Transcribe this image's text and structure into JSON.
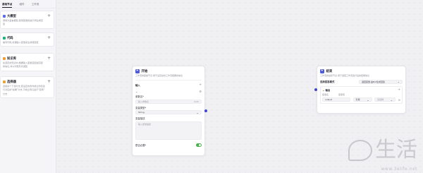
{
  "panel": {
    "tabs": [
      {
        "label": "基础节点"
      },
      {
        "label": "组件"
      },
      {
        "label": "工作流"
      }
    ],
    "cards": [
      {
        "title": "大模型",
        "desc_lines": [
          "调用大语言模型,使用变量和提示词生成回",
          "复"
        ],
        "color": "#5b6cf0",
        "icon": "brain-icon"
      },
      {
        "title": "代码",
        "desc_lines": [
          "编写代码,处理输入变量来生成返回值"
        ],
        "color": "#22b07d",
        "icon": "code-icon"
      },
      {
        "title": "知识库",
        "desc_lines": [
          "在选定的知识中,根据输入变量召回最匹配",
          "的信息,并以列表形式返回"
        ],
        "color": "#f29c38",
        "icon": "database-icon"
      },
      {
        "title": "选择器",
        "desc_lines": [
          "连接多个下游分支,若设定的条件成立则仅运",
          "行对应的\"如果\"分支,不成立则只运行\"否则\"",
          "分支"
        ],
        "color": "#e8a33d",
        "icon": "branch-icon"
      }
    ]
  },
  "start_node": {
    "title": "开始",
    "desc": "工作流的起始节点,用于设定启动工作流需要的信息",
    "input_label": "输入",
    "param_name_label": "参数名*",
    "param_name_placeholder": "输入参数名",
    "param_name_count": "0/20",
    "var_type_label": "变量类型*",
    "var_type_value": "String",
    "var_desc_label": "变量描述",
    "var_desc_placeholder": "输入变量描述",
    "required_label": "是否必要*"
  },
  "end_node": {
    "title": "结束",
    "desc": "工作流的最终节点,用于返回工作流运行后的结果信息",
    "return_mode_label": "选择回答模式",
    "return_mode_value": "返回变量,由Bot生成回答",
    "output_label": "输出",
    "col_var_name": "变量名",
    "col_var_value": "变量值",
    "row_name": "output",
    "row_ref": "引用",
    "row_select": "请选择"
  },
  "watermark": {
    "text": "生活",
    "url": "www.3elife.net"
  }
}
